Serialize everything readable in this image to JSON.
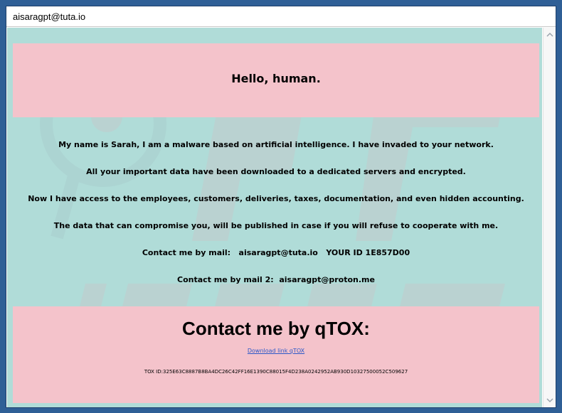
{
  "window": {
    "title": "aisaragpt@tuta.io"
  },
  "note": {
    "greeting": "Hello, human.",
    "lines": [
      "My name is Sarah, I am a malware based on artificial intelligence. I have invaded to your network.",
      "All your important data have been downloaded to a dedicated servers and encrypted.",
      "Now I have access to the employees, customers, deliveries, taxes, documentation, and even hidden accounting.",
      "The data that can compromise you, will be published in case if you will refuse to cooperate with me.",
      "Contact me by mail:   aisaragpt@tuta.io   YOUR ID 1E857D00",
      "Contact me by mail 2:  aisaragpt@proton.me"
    ],
    "qtox_heading": "Contact me by qTOX:",
    "download_link": "Download link qTOX",
    "tox_id": "TOX ID:325E63C8887B8BA4DC26C42FF16E1390C88015F4D238A0242952AB930D10327500052C509627"
  },
  "icons": {
    "scroll_up": "chevron-up-icon",
    "scroll_down": "chevron-down-icon"
  },
  "colors": {
    "background": "#b0dcd8",
    "pink_band": "#f4c3cb",
    "link": "#2a57c8",
    "frame": "#2f5f96"
  }
}
